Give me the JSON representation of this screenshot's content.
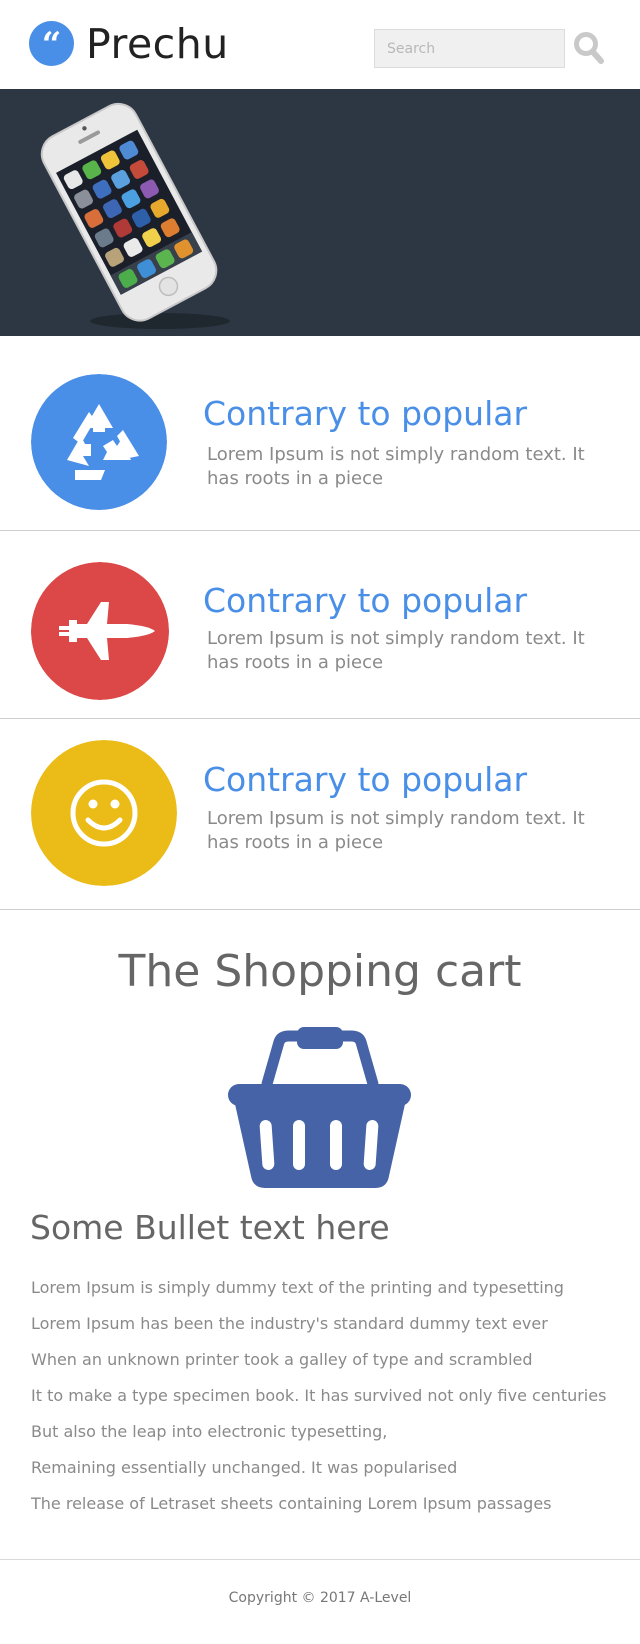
{
  "header": {
    "logo_glyph": "“",
    "brand": "Prechu",
    "search_placeholder": "Search",
    "search_icon": "search-icon"
  },
  "hero": {
    "image": "smartphone-image"
  },
  "features": [
    {
      "icon": "recycle-icon",
      "color": "#4a8fe7",
      "title": "Contrary to popular",
      "text": "Lorem Ipsum is not simply random text. It has roots in a piece"
    },
    {
      "icon": "space-shuttle-icon",
      "color": "#dc4747",
      "title": "Contrary to popular",
      "text": "Lorem Ipsum is not simply random text. It has roots in a piece"
    },
    {
      "icon": "smiley-icon",
      "color": "#ebbb17",
      "title": "Contrary to popular",
      "text": "Lorem Ipsum is not simply random text. It has roots in a piece"
    }
  ],
  "cart": {
    "title": "The Shopping cart",
    "icon": "shopping-basket-icon",
    "icon_color": "#4563a6"
  },
  "bullets": {
    "heading": "Some Bullet text here",
    "items": [
      "Lorem Ipsum is simply dummy text of the printing and typesetting",
      "Lorem Ipsum has been the industry's standard dummy text ever",
      "When an unknown printer took a galley of type and scrambled",
      "It to make a type specimen book. It has survived not only five centuries",
      "But also the leap into electronic typesetting,",
      "Remaining essentially unchanged. It was popularised",
      "The release of Letraset sheets containing Lorem Ipsum passages"
    ]
  },
  "footer": {
    "copyright": "Copyright © 2017 A-Level"
  },
  "colors": {
    "accent": "#4a8fe7",
    "hero_bg": "#2d3743",
    "text_gray": "#8a8a8a"
  }
}
